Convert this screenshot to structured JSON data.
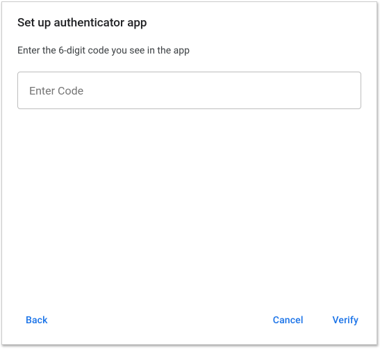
{
  "dialog": {
    "title": "Set up authenticator app",
    "instruction": "Enter the 6-digit code you see in the app",
    "code_placeholder": "Enter Code",
    "code_value": ""
  },
  "buttons": {
    "back": "Back",
    "cancel": "Cancel",
    "verify": "Verify"
  }
}
